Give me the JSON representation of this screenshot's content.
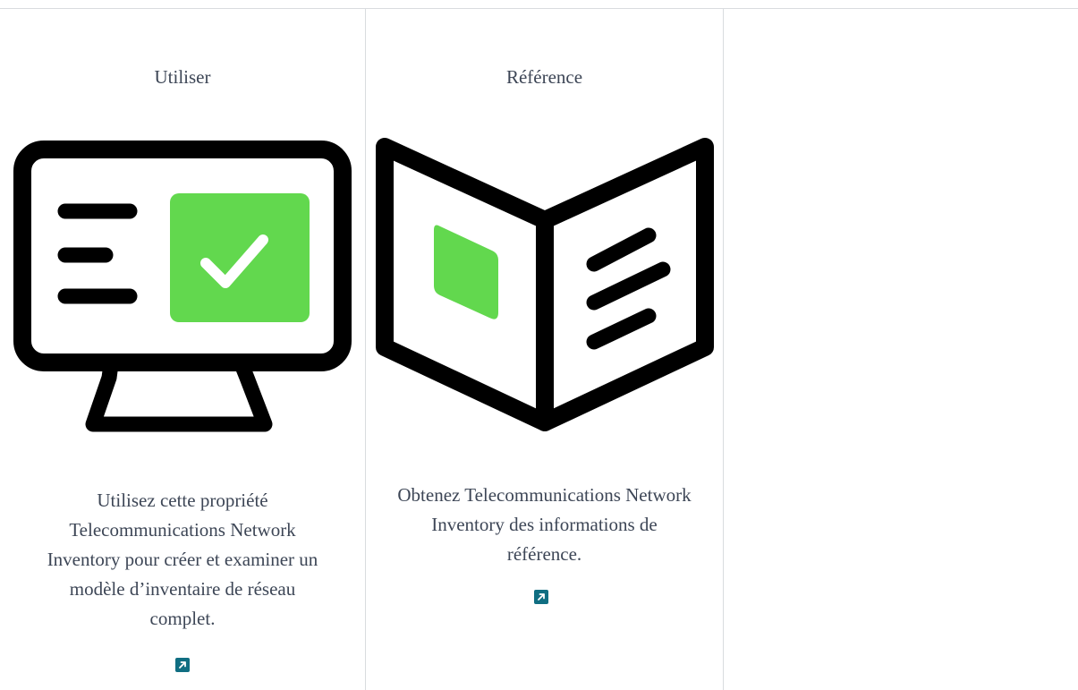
{
  "cards": [
    {
      "title": "Utiliser",
      "icon": "monitor-checkmark-icon",
      "description": "Utilisez cette propriété Telecommunications Network Inventory pour créer et examiner un modèle d’inventaire de réseau complet.",
      "link_icon": "external-link-icon"
    },
    {
      "title": "Référence",
      "icon": "open-book-icon",
      "description": "Obtenez Telecommunications Network Inventory des informations de référence.",
      "link_icon": "external-link-icon"
    }
  ],
  "colors": {
    "accent_green": "#62d84e",
    "link_teal": "#106e82",
    "text": "#3d4656",
    "divider": "#d9dcdf",
    "icon_stroke": "#000000"
  }
}
